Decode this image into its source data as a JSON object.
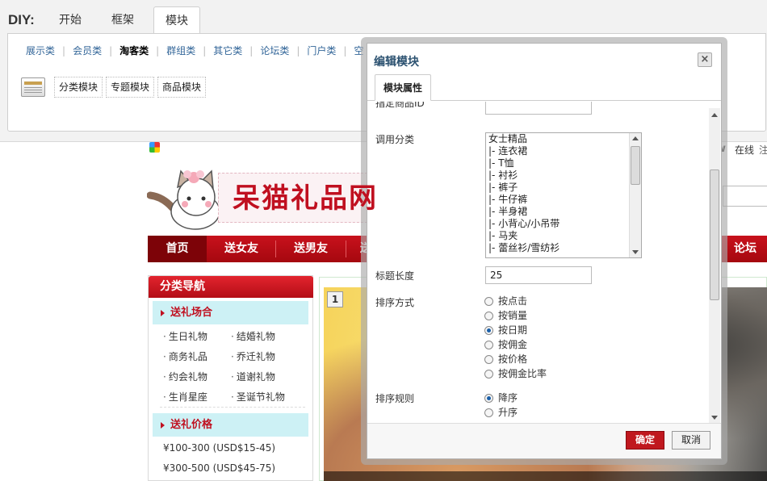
{
  "diy": {
    "label": "DIY:",
    "tabs": [
      "开始",
      "框架",
      "模块"
    ],
    "categories": [
      "展示类",
      "会员类",
      "淘客类",
      "群组类",
      "其它类",
      "论坛类",
      "门户类",
      "空"
    ],
    "modules": [
      "分类模块",
      "专题模块",
      "商品模块"
    ]
  },
  "site": {
    "logo_text": "呆猫礼品网",
    "top_right": {
      "w": "w",
      "online": "在线",
      "extra": "注"
    },
    "nav": [
      "首页",
      "送女友",
      "送男友",
      "送",
      "论坛"
    ],
    "category_nav": {
      "title": "分类导航",
      "occasion_title": "送礼场合",
      "occasions": [
        "生日礼物",
        "结婚礼物",
        "商务礼品",
        "乔迁礼物",
        "约会礼物",
        "道谢礼物",
        "生肖星座",
        "圣诞节礼物"
      ],
      "price_title": "送礼价格",
      "prices": [
        "¥100-300 (USD$15-45)",
        "¥300-500 (USD$45-75)"
      ]
    },
    "banner_number": "1"
  },
  "dialog": {
    "title": "编辑模块",
    "close": "×",
    "tab": "模块属性",
    "partial_label": "指定商品ID",
    "category_label": "调用分类",
    "category_options": [
      "女士精品",
      "|- 连衣裙",
      "|- T恤",
      "|- 衬衫",
      "|- 裤子",
      "|- 牛仔裤",
      "|- 半身裙",
      "|- 小背心/小吊带",
      "|- 马夹",
      "|- 蕾丝衫/雪纺衫"
    ],
    "title_length_label": "标题长度",
    "title_length_value": "25",
    "sort_by_label": "排序方式",
    "sort_by_options": [
      "按点击",
      "按销量",
      "按日期",
      "按佣金",
      "按价格",
      "按佣金比率"
    ],
    "sort_by_selected": 2,
    "sort_rule_label": "排序规则",
    "sort_rule_options": [
      "降序",
      "升序"
    ],
    "sort_rule_selected": 0,
    "ok": "确定",
    "cancel": "取消"
  }
}
